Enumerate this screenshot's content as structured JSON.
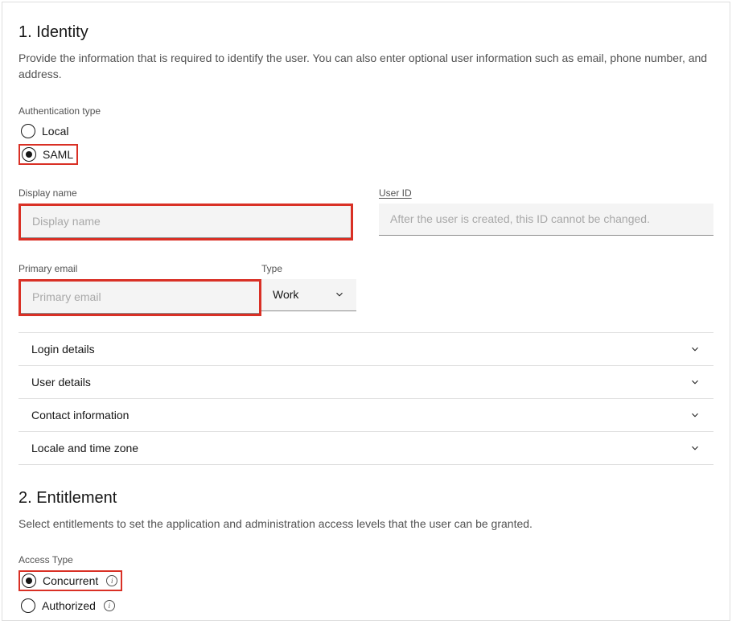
{
  "identity": {
    "title": "1. Identity",
    "description": "Provide the information that is required to identify the user. You can also enter optional user information such as email, phone number, and address.",
    "auth_label": "Authentication type",
    "auth_options": {
      "local": "Local",
      "saml": "SAML"
    },
    "display_name_label": "Display name",
    "display_name_placeholder": "Display name",
    "user_id_label": "User ID",
    "user_id_placeholder": "After the user is created, this ID cannot be changed.",
    "primary_email_label": "Primary email",
    "primary_email_placeholder": "Primary email",
    "email_type_label": "Type",
    "email_type_value": "Work",
    "accordion": {
      "login": "Login details",
      "user": "User details",
      "contact": "Contact information",
      "locale": "Locale and time zone"
    }
  },
  "entitlement": {
    "title": "2. Entitlement",
    "description": "Select entitlements to set the application and administration access levels that the user can be granted.",
    "access_label": "Access Type",
    "access_options": {
      "concurrent": "Concurrent",
      "authorized": "Authorized"
    }
  }
}
